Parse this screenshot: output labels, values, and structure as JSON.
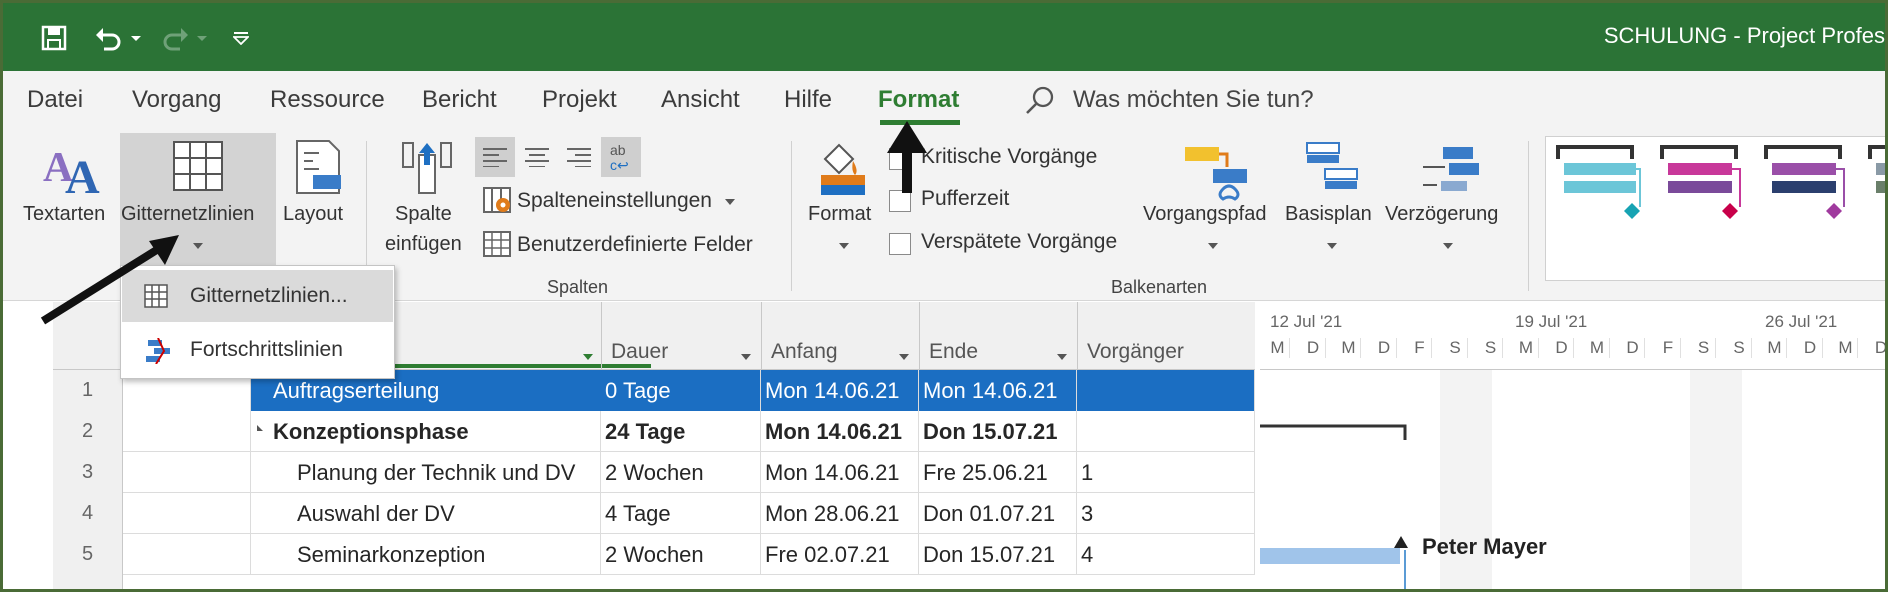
{
  "window": {
    "title": "SCHULUNG  -  Project Profes"
  },
  "qat": {
    "icons": [
      "save-icon",
      "undo-icon",
      "redo-icon",
      "customize-icon"
    ]
  },
  "tabs": [
    {
      "label": "Datei"
    },
    {
      "label": "Vorgang"
    },
    {
      "label": "Ressource"
    },
    {
      "label": "Bericht"
    },
    {
      "label": "Projekt"
    },
    {
      "label": "Ansicht"
    },
    {
      "label": "Hilfe"
    },
    {
      "label": "Format",
      "active": true
    }
  ],
  "tellme": {
    "text": "Was möchten Sie tun?"
  },
  "ribbon": {
    "format_group": {
      "textarten": "Textarten",
      "gitternetzlinien": "Gitternetzlinien",
      "layout": "Layout"
    },
    "spalten": {
      "spalte_einfuegen_line1": "Spalte",
      "spalte_einfuegen_line2": "einfügen",
      "spalteneinstellungen": "Spalteneinstellungen",
      "benutzerdefinierte_felder": "Benutzerdefinierte Felder",
      "group_label": "Spalten"
    },
    "balkenarten": {
      "format": "Format",
      "kritische_vorgaenge": "Kritische Vorgänge",
      "pufferzeit": "Pufferzeit",
      "verspaetete_vorgaenge": "Verspätete Vorgänge",
      "vorgangspfad": "Vorgangspfad",
      "basisplan": "Basisplan",
      "verzoegerung": "Verzögerung",
      "group_label": "Balkenarten"
    },
    "colors": {
      "gallery1": "#6cc6d8",
      "gallery2": "#c8389a",
      "gallery3": "#9a4fa8",
      "accent_green": "#2b7336"
    }
  },
  "menu": {
    "items": [
      {
        "label": "Gitternetzlinien...",
        "icon": "grid-icon"
      },
      {
        "label": "Fortschrittslinien",
        "icon": "progress-lines-icon"
      }
    ]
  },
  "sheet": {
    "columns": [
      "Dauer",
      "Anfang",
      "Ende",
      "Vorgänger"
    ],
    "rows": [
      {
        "num": "1",
        "name": "Auftragserteilung",
        "dauer": "0 Tage",
        "anfang": "Mon 14.06.21",
        "ende": "Mon 14.06.21",
        "vorg": "",
        "selected": true
      },
      {
        "num": "2",
        "name": "Konzeptionsphase",
        "dauer": "24 Tage",
        "anfang": "Mon 14.06.21",
        "ende": "Don 15.07.21",
        "vorg": "",
        "bold": true
      },
      {
        "num": "3",
        "name": "Planung der Technik und DV",
        "dauer": "2 Wochen",
        "anfang": "Mon 14.06.21",
        "ende": "Fre 25.06.21",
        "vorg": "1"
      },
      {
        "num": "4",
        "name": "Auswahl der DV",
        "dauer": "4 Tage",
        "anfang": "Mon 28.06.21",
        "ende": "Don 01.07.21",
        "vorg": "3"
      },
      {
        "num": "5",
        "name": "Seminarkonzeption",
        "dauer": "2 Wochen",
        "anfang": "Fre 02.07.21",
        "ende": "Don 15.07.21",
        "vorg": "4"
      }
    ]
  },
  "timescale": {
    "weeks": [
      "12 Jul '21",
      "19 Jul '21",
      "26 Jul '21"
    ],
    "days": [
      "M",
      "D",
      "M",
      "D",
      "F",
      "S",
      "S",
      "M",
      "D",
      "M",
      "D",
      "F",
      "S",
      "S",
      "M",
      "D",
      "M",
      "D"
    ]
  },
  "gantt": {
    "resource_label": "Peter Mayer"
  }
}
